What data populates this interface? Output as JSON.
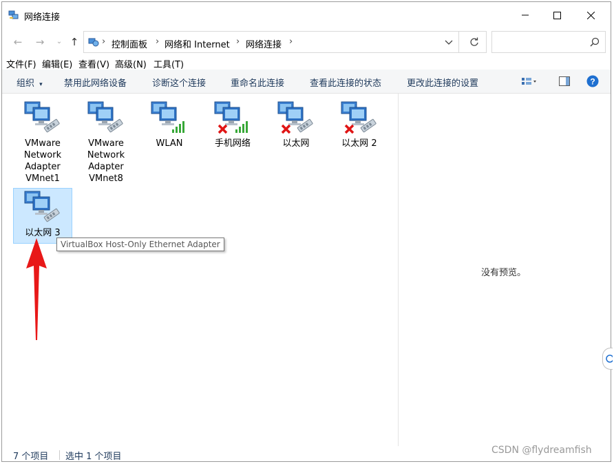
{
  "window": {
    "title": "网络连接",
    "icon": "network-connections-icon",
    "caption_buttons": [
      "minimize-icon",
      "maximize-icon",
      "close-icon"
    ]
  },
  "address": {
    "breadcrumbs": [
      "控制面板",
      "网络和 Internet",
      "网络连接"
    ],
    "search_placeholder": ""
  },
  "menu": [
    "文件(F)",
    "编辑(E)",
    "查看(V)",
    "高级(N)",
    "工具(T)"
  ],
  "toolbar": {
    "items": [
      "组织",
      "禁用此网络设备",
      "诊断这个连接",
      "重命名此连接",
      "查看此连接的状态",
      "更改此连接的设置"
    ],
    "organize_dropdown": "▾"
  },
  "connections": [
    {
      "name": "VMware Network Adapter VMnet1",
      "lines": [
        "VMware",
        "Network",
        "Adapter",
        "VMnet1"
      ],
      "kind": "ethernet",
      "status": "ok"
    },
    {
      "name": "VMware Network Adapter VMnet8",
      "lines": [
        "VMware",
        "Network",
        "Adapter",
        "VMnet8"
      ],
      "kind": "ethernet",
      "status": "ok"
    },
    {
      "name": "WLAN",
      "lines": [
        "WLAN"
      ],
      "kind": "wireless",
      "status": "ok"
    },
    {
      "name": "手机网络",
      "lines": [
        "手机网络"
      ],
      "kind": "wireless",
      "status": "disconnected"
    },
    {
      "name": "以太网",
      "lines": [
        "以太网"
      ],
      "kind": "ethernet",
      "status": "disconnected"
    },
    {
      "name": "以太网 2",
      "lines": [
        "以太网 2"
      ],
      "kind": "ethernet",
      "status": "disconnected"
    },
    {
      "name": "以太网 3",
      "lines": [
        "以太网 3"
      ],
      "kind": "ethernet",
      "status": "ok",
      "selected": true
    }
  ],
  "tooltip": "VirtualBox Host-Only Ethernet Adapter",
  "preview": {
    "text": "没有预览。"
  },
  "status": {
    "count": "7 个项目",
    "selected": "选中 1 个项目"
  },
  "watermark": "CSDN @flydreamfish",
  "colors": {
    "selection_bg": "#cce8ff",
    "toolbar_text": "#1e395b",
    "annotation_arrow": "#e81818"
  }
}
